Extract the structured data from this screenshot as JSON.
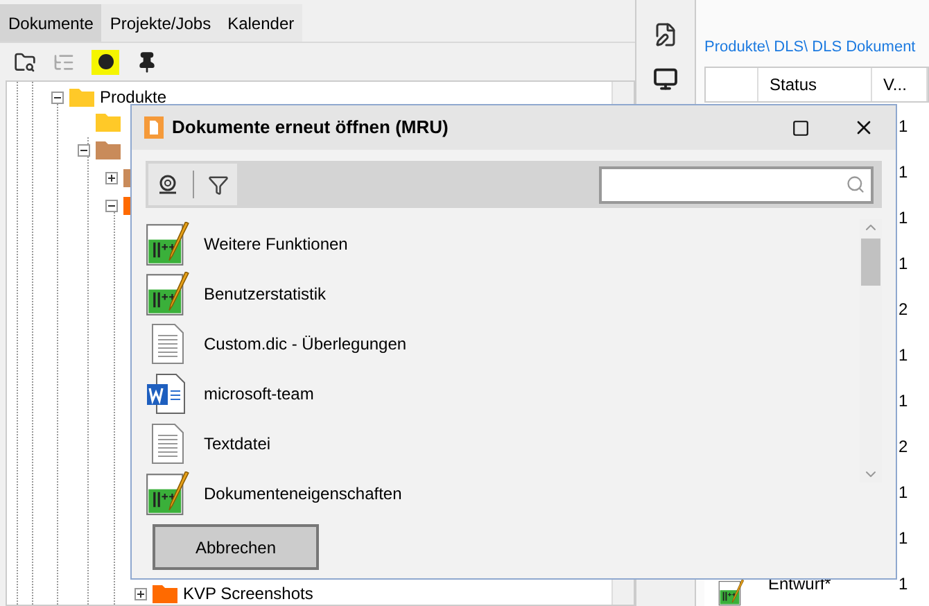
{
  "tabs": [
    {
      "label": "Dokumente",
      "selected": true
    },
    {
      "label": "Projekte/Jobs",
      "selected": false
    },
    {
      "label": "Kalender",
      "selected": false
    }
  ],
  "tree": [
    {
      "label": "Produkte",
      "expanded": true,
      "kind": "yellow"
    },
    {
      "label": "KVP Screenshots",
      "expanded": false,
      "kind": "orange"
    }
  ],
  "breadcrumb": "Produkte\\ DLS\\ DLS Dokument",
  "table": {
    "columns": [
      "Status",
      "V..."
    ],
    "rows": [
      {
        "column_3": "1"
      },
      {
        "column_3": "1"
      },
      {
        "column_3": "1"
      },
      {
        "column_3": "1"
      },
      {
        "column_3": "2"
      },
      {
        "column_3": "1"
      },
      {
        "column_3": "1"
      },
      {
        "column_3": "2"
      },
      {
        "column_3": "1"
      },
      {
        "column_3": "1"
      },
      {
        "status": "Entwurf*",
        "column_3": "1"
      }
    ]
  },
  "dialog": {
    "title": "Dokumente erneut öffnen (MRU)",
    "items": [
      {
        "label": "Weitere Funktionen",
        "kind": "notepad"
      },
      {
        "label": "Benutzerstatistik",
        "kind": "notepad"
      },
      {
        "label": "Custom.dic - Überlegungen",
        "kind": "text"
      },
      {
        "label": "microsoft-team",
        "kind": "word"
      },
      {
        "label": "Textdatei",
        "kind": "text"
      },
      {
        "label": "Dokumenteneigenschaften",
        "kind": "notepad"
      }
    ],
    "cancel": "Abbrechen"
  }
}
